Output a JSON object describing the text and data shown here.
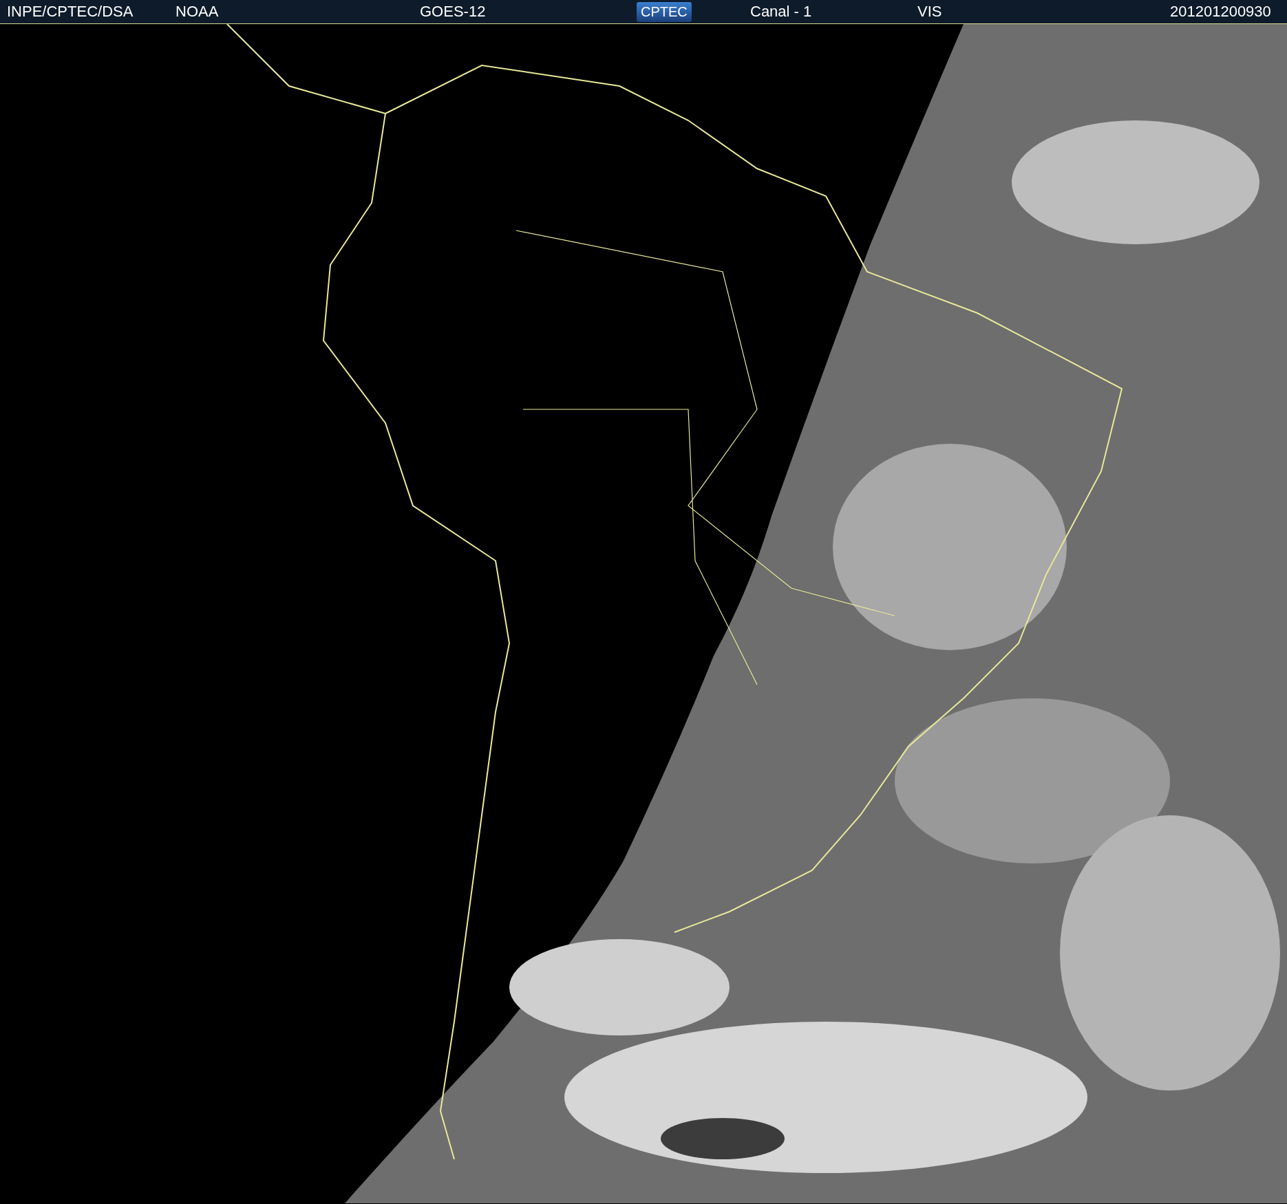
{
  "header": {
    "items": [
      {
        "kind": "text",
        "text": "INPE/CPTEC/DSA"
      },
      {
        "kind": "text",
        "text": "NOAA"
      },
      {
        "kind": "text",
        "text": "GOES-12"
      },
      {
        "kind": "logo",
        "text": "CPTEC"
      },
      {
        "kind": "text",
        "text": "Canal - 1"
      },
      {
        "kind": "text",
        "text": "VIS"
      },
      {
        "kind": "text",
        "text": "201201200930"
      }
    ]
  }
}
